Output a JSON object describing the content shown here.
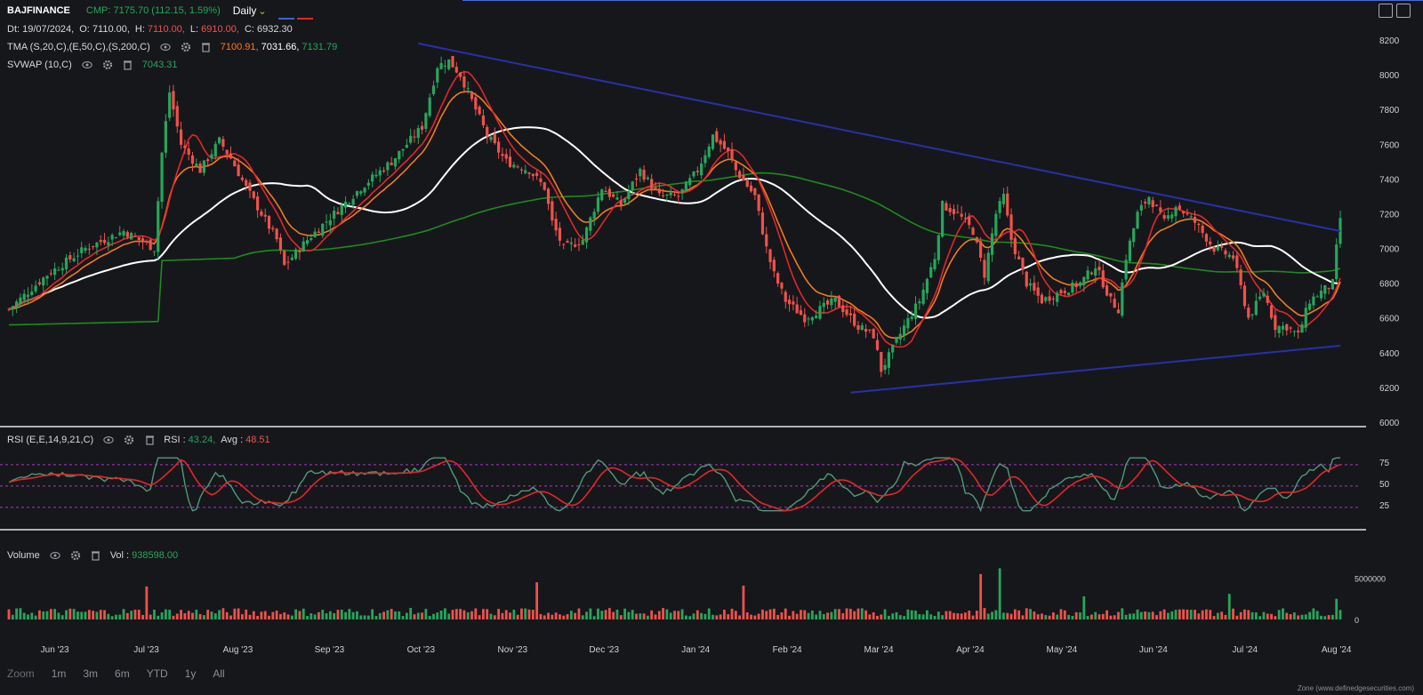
{
  "header": {
    "symbol": "BAJFINANCE",
    "cmp": "CMP: 7175.70 (112.15, 1.59%)",
    "interval": "Daily",
    "ohlc": {
      "dt": "Dt: 19/07/2024,",
      "o": "O: 7110.00,",
      "h_label": "H:",
      "h": "7110.00,",
      "l_label": "L:",
      "l": "6910.00,",
      "c": "C: 6932.30"
    }
  },
  "indicators": {
    "tma": {
      "label": "TMA (S,20,C),(E,50,C),(S,200,C)",
      "v1": "7100.91,",
      "v2": "7031.66,",
      "v3": "7131.79"
    },
    "svwap": {
      "label": "SVWAP (10,C)",
      "value": "7043.31"
    },
    "rsi": {
      "label": "RSI (E,E,14,9,21,C)",
      "rsi_label": "RSI :",
      "rsi_value": "43.24,",
      "avg_label": "Avg :",
      "avg_value": "48.51"
    },
    "volume": {
      "label": "Volume",
      "vol_label": "Vol :",
      "vol_value": "938598.00"
    }
  },
  "ranges": {
    "zoom_label": "Zoom",
    "options": [
      "1m",
      "3m",
      "6m",
      "YTD",
      "1y",
      "All"
    ]
  },
  "footer": "Zone (www.definedgesecurities.com)",
  "colors": {
    "up": "#26a65b",
    "down": "#f0514a",
    "sma20": "#e3262b",
    "ema50": "#f07b1e",
    "sma200": "#1f8a1f",
    "svwap": "#ffffff",
    "trend": "#2830a8",
    "rsi": "#4f9a7a",
    "rsi_avg": "#e3262b",
    "rsi_band": "#b133c9"
  },
  "chart_data": {
    "type": "candlestick",
    "title": "BAJFINANCE",
    "price_axis": {
      "ticks": [
        8200,
        8000,
        7800,
        7600,
        7400,
        7200,
        7000,
        6800,
        6600,
        6400,
        6200,
        6000
      ],
      "ylim": [
        6000,
        8200
      ]
    },
    "x_ticks": [
      "Jun '23",
      "Jul '23",
      "Aug '23",
      "Sep '23",
      "Oct '23",
      "Nov '23",
      "Dec '23",
      "Jan '24",
      "Feb '24",
      "Mar '24",
      "Apr '24",
      "May '24",
      "Jun '24",
      "Jul '24",
      "Aug '24"
    ],
    "price_anchors": [
      [
        0,
        6650
      ],
      [
        10,
        6850
      ],
      [
        20,
        7000
      ],
      [
        30,
        7100
      ],
      [
        38,
        7000
      ],
      [
        40,
        7550
      ],
      [
        42,
        7900
      ],
      [
        45,
        7600
      ],
      [
        50,
        7450
      ],
      [
        55,
        7620
      ],
      [
        58,
        7520
      ],
      [
        62,
        7350
      ],
      [
        66,
        7200
      ],
      [
        70,
        7050
      ],
      [
        72,
        6900
      ],
      [
        78,
        7050
      ],
      [
        85,
        7200
      ],
      [
        92,
        7350
      ],
      [
        100,
        7500
      ],
      [
        108,
        7700
      ],
      [
        112,
        8050
      ],
      [
        115,
        8080
      ],
      [
        118,
        8000
      ],
      [
        120,
        7900
      ],
      [
        125,
        7650
      ],
      [
        130,
        7500
      ],
      [
        136,
        7450
      ],
      [
        140,
        7350
      ],
      [
        142,
        7150
      ],
      [
        145,
        7000
      ],
      [
        150,
        7050
      ],
      [
        155,
        7350
      ],
      [
        160,
        7250
      ],
      [
        165,
        7450
      ],
      [
        170,
        7300
      ],
      [
        175,
        7300
      ],
      [
        180,
        7450
      ],
      [
        184,
        7650
      ],
      [
        188,
        7550
      ],
      [
        190,
        7450
      ],
      [
        195,
        7300
      ],
      [
        198,
        7000
      ],
      [
        200,
        6850
      ],
      [
        203,
        6700
      ],
      [
        208,
        6600
      ],
      [
        212,
        6650
      ],
      [
        216,
        6700
      ],
      [
        222,
        6550
      ],
      [
        226,
        6500
      ],
      [
        228,
        6300
      ],
      [
        230,
        6380
      ],
      [
        234,
        6550
      ],
      [
        238,
        6700
      ],
      [
        242,
        6950
      ],
      [
        244,
        7250
      ],
      [
        248,
        7200
      ],
      [
        252,
        7100
      ],
      [
        255,
        6850
      ],
      [
        258,
        7200
      ],
      [
        260,
        7300
      ],
      [
        262,
        7050
      ],
      [
        266,
        6800
      ],
      [
        270,
        6700
      ],
      [
        275,
        6750
      ],
      [
        280,
        6800
      ],
      [
        284,
        6900
      ],
      [
        288,
        6700
      ],
      [
        290,
        6650
      ],
      [
        292,
        6950
      ],
      [
        295,
        7200
      ],
      [
        298,
        7300
      ],
      [
        302,
        7150
      ],
      [
        305,
        7250
      ],
      [
        310,
        7150
      ],
      [
        315,
        7000
      ],
      [
        320,
        6950
      ],
      [
        324,
        6600
      ],
      [
        328,
        6750
      ],
      [
        331,
        6550
      ],
      [
        334,
        6550
      ],
      [
        337,
        6500
      ],
      [
        340,
        6700
      ],
      [
        343,
        6750
      ],
      [
        346,
        6800
      ],
      [
        347,
        7000
      ],
      [
        348,
        7175
      ]
    ],
    "moving_averages": [
      {
        "name": "SMA 20",
        "color": "#e3262b",
        "last": 7100.91
      },
      {
        "name": "EMA 50",
        "color": "#f07b1e",
        "last": 7031.66
      },
      {
        "name": "SMA 200",
        "color": "#1f8a1f",
        "last": 7131.79
      },
      {
        "name": "SVWAP 10",
        "color": "#ffffff",
        "last": 7043.31
      }
    ],
    "trendlines": [
      {
        "from": [
          107,
          8180
        ],
        "to": [
          348,
          7100
        ]
      },
      {
        "from": [
          220,
          6170
        ],
        "to": [
          348,
          6440
        ]
      }
    ],
    "rsi": {
      "ticks": [
        75,
        50,
        25
      ],
      "bands": [
        72,
        47,
        22
      ],
      "last": 43.24,
      "avg_last": 48.51
    },
    "volume": {
      "ticks": [
        "5000000",
        "0"
      ],
      "ylim": [
        0,
        7000000
      ],
      "last": 938598,
      "spikes": [
        [
          36,
          4000000
        ],
        [
          138,
          4500000
        ],
        [
          192,
          4100000
        ],
        [
          254,
          5500000
        ],
        [
          259,
          6200000
        ],
        [
          281,
          2800000
        ],
        [
          319,
          3100000
        ],
        [
          347,
          2500000
        ]
      ]
    }
  }
}
